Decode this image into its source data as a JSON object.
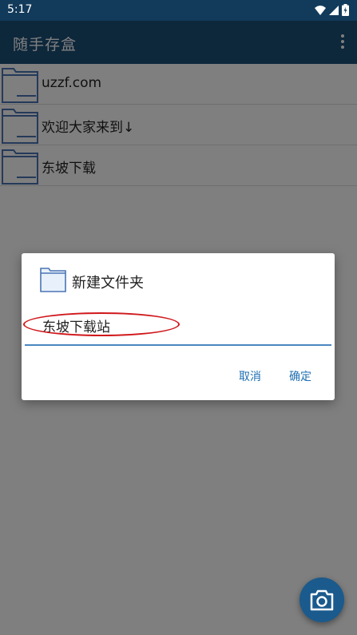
{
  "status_bar": {
    "time": "5:17",
    "icons": [
      "wifi-icon",
      "signal-icon",
      "battery-icon"
    ]
  },
  "app_bar": {
    "title": "随手存盒",
    "menu_icon": "more-vert-icon"
  },
  "folders": [
    {
      "name": "uzzf.com"
    },
    {
      "name": "欢迎大家来到↓"
    },
    {
      "name": "东坡下载"
    }
  ],
  "dialog": {
    "title": "新建文件夹",
    "input_value": "东坡下载站",
    "cancel_label": "取消",
    "ok_label": "确定"
  },
  "fab": {
    "icon": "camera-icon"
  },
  "colors": {
    "status_bar": "#123a5a",
    "app_bar": "#1b4f77",
    "accent": "#1f6fb2",
    "annotation_red": "#d0181c"
  }
}
